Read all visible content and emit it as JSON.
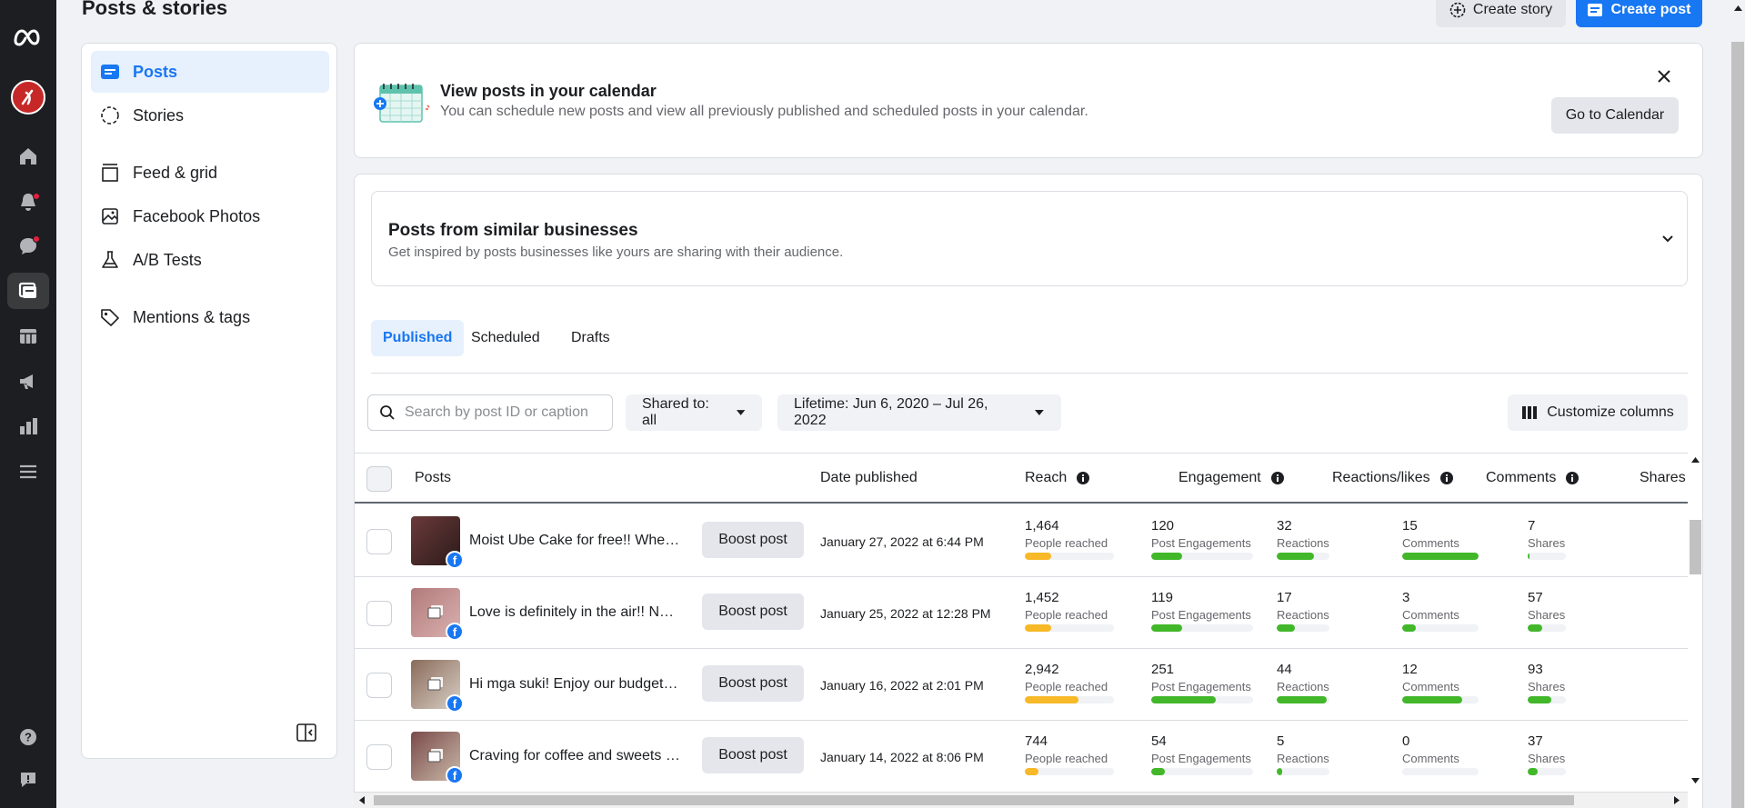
{
  "header": {
    "title": "Posts & stories",
    "create_story": "Create story",
    "create_post": "Create post"
  },
  "rail": {
    "items": [
      "meta-logo-icon",
      "avatar",
      "home-icon",
      "notifications-icon",
      "messages-icon",
      "posts-icon",
      "content-icon",
      "ads-icon",
      "insights-icon",
      "menu-icon",
      "help-icon",
      "feedback-icon"
    ]
  },
  "sidebar": {
    "items": [
      {
        "label": "Posts",
        "icon": "posts-icon",
        "active": true
      },
      {
        "label": "Stories",
        "icon": "stories-icon"
      },
      {
        "label": "Feed & grid",
        "icon": "feed-grid-icon"
      },
      {
        "label": "Facebook Photos",
        "icon": "photos-icon"
      },
      {
        "label": "A/B Tests",
        "icon": "flask-icon"
      },
      {
        "label": "Mentions & tags",
        "icon": "tag-icon"
      }
    ]
  },
  "banner": {
    "title": "View posts in your calendar",
    "subtitle": "You can schedule new posts and view all previously published and scheduled posts in your calendar.",
    "button": "Go to Calendar"
  },
  "similar": {
    "title": "Posts from similar businesses",
    "subtitle": "Get inspired by posts businesses like yours are sharing with their audience."
  },
  "tabs": [
    "Published",
    "Scheduled",
    "Drafts"
  ],
  "filters": {
    "search_placeholder": "Search by post ID or caption",
    "shared_to": "Shared to: all",
    "lifetime": "Lifetime: Jun 6, 2020 – Jul 26, 2022",
    "customize": "Customize columns"
  },
  "table": {
    "columns": {
      "posts": "Posts",
      "date": "Date published",
      "reach": "Reach",
      "engagement": "Engagement",
      "reactions": "Reactions/likes",
      "comments": "Comments",
      "shares": "Shares"
    },
    "boost_label": "Boost post",
    "metric_labels": {
      "reach": "People reached",
      "engagement": "Post Engagements",
      "reactions": "Reactions",
      "comments": "Comments",
      "shares": "Shares"
    },
    "rows": [
      {
        "caption": "Moist Ube Cake for free!! When yo...",
        "date": "January 27, 2022 at 6:44 PM",
        "reach": "1,464",
        "engagement": "120",
        "reactions": "32",
        "comments": "15",
        "shares": "7",
        "fill": {
          "reach": 0.3,
          "engagement": 0.3,
          "reactions": 0.7,
          "comments": 1.0,
          "shares": 0.05
        }
      },
      {
        "caption": "Love is definitely in the air!! Nalala...",
        "date": "January 25, 2022 at 12:28 PM",
        "reach": "1,452",
        "engagement": "119",
        "reactions": "17",
        "comments": "3",
        "shares": "57",
        "fill": {
          "reach": 0.3,
          "engagement": 0.3,
          "reactions": 0.35,
          "comments": 0.18,
          "shares": 0.38
        }
      },
      {
        "caption": "Hi mga suki! Enjoy our budget frie...",
        "date": "January 16, 2022 at 2:01 PM",
        "reach": "2,942",
        "engagement": "251",
        "reactions": "44",
        "comments": "12",
        "shares": "93",
        "fill": {
          "reach": 0.6,
          "engagement": 0.63,
          "reactions": 0.95,
          "comments": 0.78,
          "shares": 0.62
        }
      },
      {
        "caption": "Craving for coffee and sweets but...",
        "date": "January 14, 2022 at 8:06 PM",
        "reach": "744",
        "engagement": "54",
        "reactions": "5",
        "comments": "0",
        "shares": "37",
        "fill": {
          "reach": 0.15,
          "engagement": 0.13,
          "reactions": 0.1,
          "comments": 0.0,
          "shares": 0.25
        }
      }
    ]
  },
  "colors": {
    "accent": "#1877f2",
    "reach_bar": "#f7b928",
    "metric_bar": "#42b72a"
  }
}
